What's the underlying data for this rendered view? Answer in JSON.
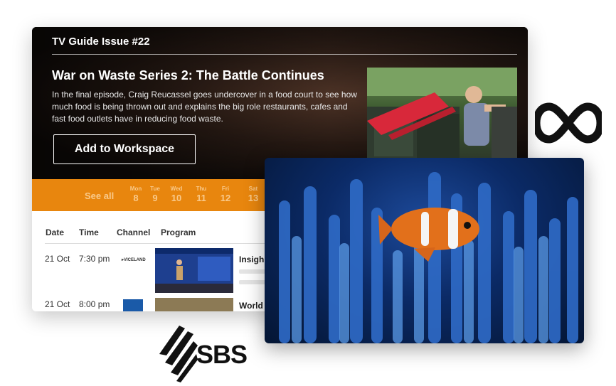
{
  "guide": {
    "issue_title": "TV Guide Issue #22",
    "show_title": "War on Waste Series 2: The Battle Continues",
    "show_description": "In the final episode, Craig Reucassel goes undercover in a food court to see how much food is being thrown out and explains the big role restaurants, cafes and fast food outlets have in reducing food waste.",
    "add_button": "Add to Workspace"
  },
  "date_bar": {
    "see_all": "See all",
    "days": [
      {
        "name": "Mon",
        "date": "8"
      },
      {
        "name": "Tue",
        "date": "9"
      },
      {
        "name": "Wed",
        "date": "10"
      },
      {
        "name": "Thu",
        "date": "11"
      },
      {
        "name": "Fri",
        "date": "12"
      },
      {
        "name": "Sat",
        "date": "13"
      }
    ]
  },
  "table": {
    "headers": {
      "date": "Date",
      "time": "Time",
      "channel": "Channel",
      "program": "Program"
    },
    "rows": [
      {
        "date": "21 Oct",
        "time": "7:30 pm",
        "channel_logo": "VICELAND",
        "program": "Insigh"
      },
      {
        "date": "21 Oct",
        "time": "8:00 pm",
        "channel_logo": "abc-logo",
        "program": "World"
      }
    ]
  },
  "brands": {
    "sbs": "SBS",
    "abc_icon": "abc-logo-icon"
  },
  "colors": {
    "accent_orange": "#e8860e",
    "hero_dark": "#111111"
  }
}
